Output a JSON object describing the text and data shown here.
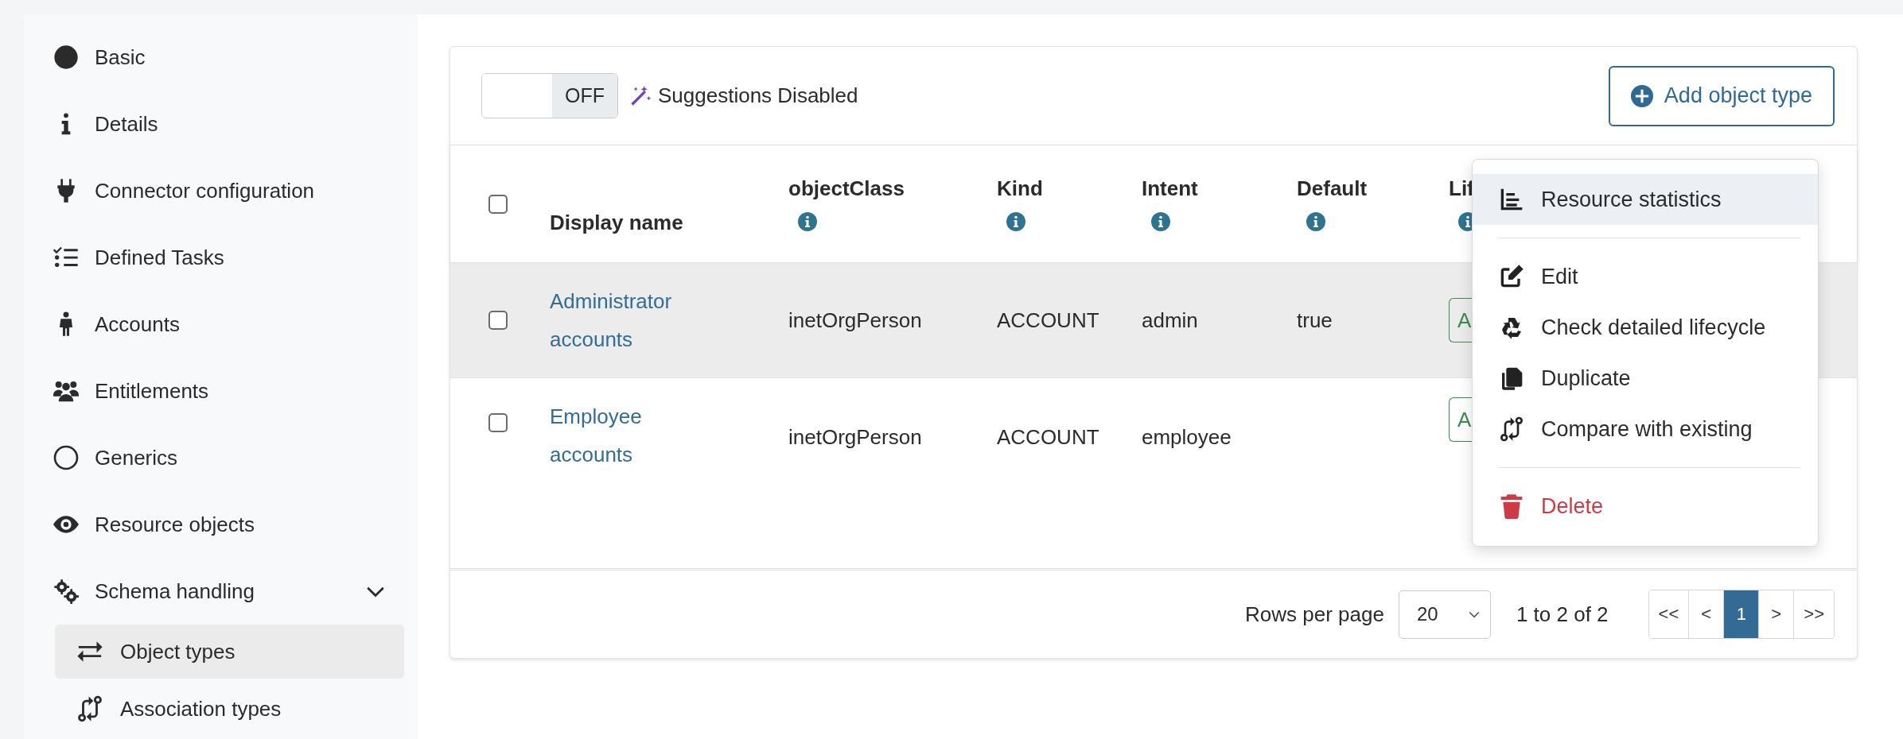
{
  "sidebar": {
    "items": [
      {
        "label": "Basic",
        "selected": false
      },
      {
        "label": "Details",
        "selected": false
      },
      {
        "label": "Connector configuration",
        "selected": false
      },
      {
        "label": "Defined Tasks",
        "selected": false
      },
      {
        "label": "Accounts",
        "selected": false
      },
      {
        "label": "Entitlements",
        "selected": false
      },
      {
        "label": "Generics",
        "selected": false
      },
      {
        "label": "Resource objects",
        "selected": false
      },
      {
        "label": "Schema handling",
        "selected": false,
        "expanded": true,
        "children": [
          {
            "label": "Object types",
            "selected": true
          },
          {
            "label": "Association types",
            "selected": false
          }
        ]
      }
    ]
  },
  "toolbar": {
    "suggestions_toggle": {
      "on": false,
      "label": "OFF"
    },
    "suggestions_label": "Suggestions Disabled",
    "add_button": "Add object type"
  },
  "table": {
    "select_all": {
      "checked": false
    },
    "columns": [
      {
        "label": "Display name",
        "info": false
      },
      {
        "label": "objectClass",
        "info": true
      },
      {
        "label": "Kind",
        "info": true
      },
      {
        "label": "Intent",
        "info": true
      },
      {
        "label": "Default",
        "info": true
      },
      {
        "label": "Lif",
        "info": true
      }
    ],
    "rows": [
      {
        "checked": false,
        "hovered": true,
        "display_name": "Administrator accounts",
        "object_class": "inetOrgPerson",
        "kind": "ACCOUNT",
        "intent": "admin",
        "default": "true",
        "column_6": "A"
      },
      {
        "checked": false,
        "hovered": false,
        "display_name": "Employee accounts",
        "object_class": "inetOrgPerson",
        "kind": "ACCOUNT",
        "intent": "employee",
        "column_6": "A"
      }
    ]
  },
  "context_menu": {
    "sections": [
      {
        "items": [
          {
            "label": "Resource statistics",
            "selected": true,
            "kind": "normal"
          }
        ]
      },
      {
        "items": [
          {
            "label": "Edit",
            "selected": false,
            "kind": "normal"
          },
          {
            "label": "Check detailed lifecycle",
            "selected": false,
            "kind": "normal"
          },
          {
            "label": "Duplicate",
            "selected": false,
            "kind": "normal"
          },
          {
            "label": "Compare with existing",
            "selected": false,
            "kind": "normal"
          }
        ]
      },
      {
        "items": [
          {
            "label": "Delete",
            "selected": false,
            "kind": "danger"
          }
        ]
      }
    ]
  },
  "pagination": {
    "rows_per_page_label": "Rows per page",
    "rows_per_page": "20",
    "range": "1 to 2 of 2",
    "buttons": [
      {
        "label": "<<",
        "selected": false
      },
      {
        "label": "<",
        "selected": false
      },
      {
        "label": "1",
        "selected": true
      },
      {
        "label": ">",
        "selected": false
      },
      {
        "label": ">>",
        "selected": false
      }
    ]
  }
}
